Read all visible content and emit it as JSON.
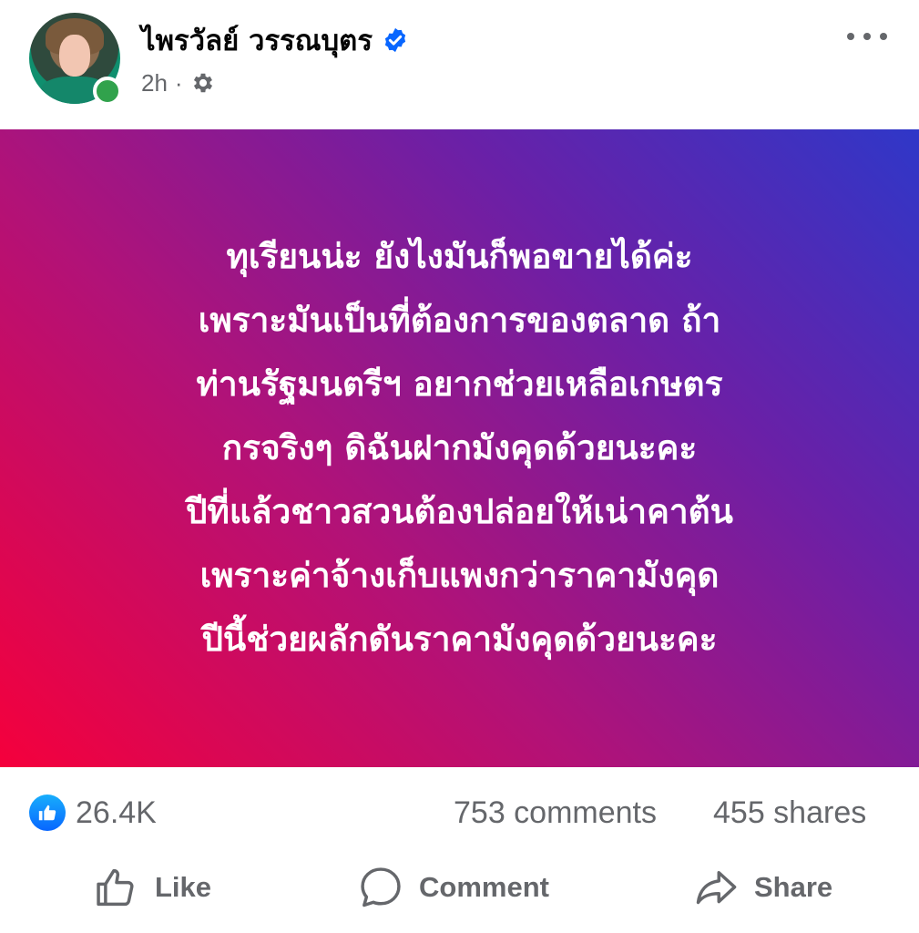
{
  "post": {
    "author": {
      "name": "ไพรวัลย์ วรรณบุตร",
      "verified": true,
      "online": true
    },
    "timestamp": "2h",
    "audience_icon": "gear-icon",
    "more_icon": "more-horizontal-icon",
    "background": {
      "gradient_colors": [
        "#f5003c",
        "#b11278",
        "#6a20a7",
        "#2f37c8"
      ],
      "text": "ทุเรียนน่ะ ยังไงมันก็พอขายได้ค่ะ\nเพราะมันเป็นที่ต้องการของตลาด ถ้า\nท่านรัฐมนตรีฯ อยากช่วยเหลือเกษตร\nกรจริงๆ    ดิฉันฝากมังคุดด้วยนะคะ\nปีที่แล้วชาวสวนต้องปล่อยให้เน่าคาต้น\nเพราะค่าจ้างเก็บแพงกว่าราคามังคุด\nปีนี้ช่วยผลักดันราคามังคุดด้วยนะคะ"
    },
    "stats": {
      "reactions": "26.4K",
      "comments": "753 comments",
      "shares": "455 shares"
    },
    "actions": {
      "like": "Like",
      "comment": "Comment",
      "share": "Share"
    },
    "colors": {
      "online": "#31a24c",
      "verified": "#0866ff",
      "secondary_text": "#65676b"
    }
  }
}
